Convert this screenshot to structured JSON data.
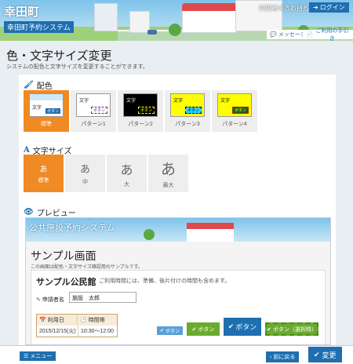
{
  "header": {
    "city": "幸田町",
    "system": "幸田町予約システム",
    "help_link": "利用者の方お持ちの方",
    "login": "ログイン",
    "message": "メッセージ",
    "guide": "ご利用の手引き"
  },
  "page": {
    "title": "色・文字サイズ変更",
    "description": "システムの配色と文字サイズを変更することができます。"
  },
  "color_section": {
    "heading": "配色",
    "schemes": [
      {
        "label": "標準",
        "text": "文字",
        "button": "ボタン",
        "selected": true,
        "bg": "#ffffff",
        "fg": "#222222",
        "btn_bg": "#1e6fb0",
        "btn_fg": "#ffffff"
      },
      {
        "label": "パターン1",
        "text": "文字",
        "button": "ボタン",
        "selected": false,
        "bg": "#ffffff",
        "fg": "#222222",
        "btn_bg": "#ffffff",
        "btn_fg": "#7a1f9a"
      },
      {
        "label": "パターン2",
        "text": "文字",
        "button": "ボタン",
        "selected": false,
        "bg": "#000000",
        "fg": "#ffffff",
        "btn_bg": "#000000",
        "btn_fg": "#ffff00"
      },
      {
        "label": "パターン3",
        "text": "文字",
        "button": "ボタン",
        "selected": false,
        "bg": "#ffff00",
        "fg": "#000000",
        "btn_bg": "#2fd5ff",
        "btn_fg": "#000000"
      },
      {
        "label": "パターン4",
        "text": "文字",
        "button": "ボタン",
        "selected": false,
        "bg": "#ffff00",
        "fg": "#000000",
        "btn_bg": "#1f5f1f",
        "btn_fg": "#ffff00"
      }
    ]
  },
  "size_section": {
    "heading": "文字サイズ",
    "sizes": [
      {
        "char": "あ",
        "label": "標準",
        "selected": true
      },
      {
        "char": "あ",
        "label": "中",
        "selected": false
      },
      {
        "char": "あ",
        "label": "大",
        "selected": false
      },
      {
        "char": "あ",
        "label": "最大",
        "selected": false
      }
    ]
  },
  "preview": {
    "heading": "プレビュー",
    "banner_title": "公共施設予約システム",
    "title": "サンプル画面",
    "description": "この画面は配色・文字サイズ確認用のサンプルです。",
    "facility": "サンプル公民館",
    "facility_note": "ご利用時間には、準備、後片付けの時間も含めます。",
    "applicant_label": "申請者名",
    "applicant_value": "施設　太郎",
    "col_date": "利用日",
    "col_time": "時間帯",
    "date_value": "2015/12/15(火)",
    "time_value": "10:30～12:00",
    "btn_small": "ボタン",
    "btn_green": "ボタン",
    "btn_blue": "ボタン",
    "btn_selected": "ボタン（選択時）"
  },
  "footer": {
    "menu": "メニュー",
    "back": "前に戻る",
    "change": "変更"
  },
  "colors": {
    "accent": "#1e6fb0",
    "selected": "#f08a24",
    "green": "#6aab2e"
  }
}
